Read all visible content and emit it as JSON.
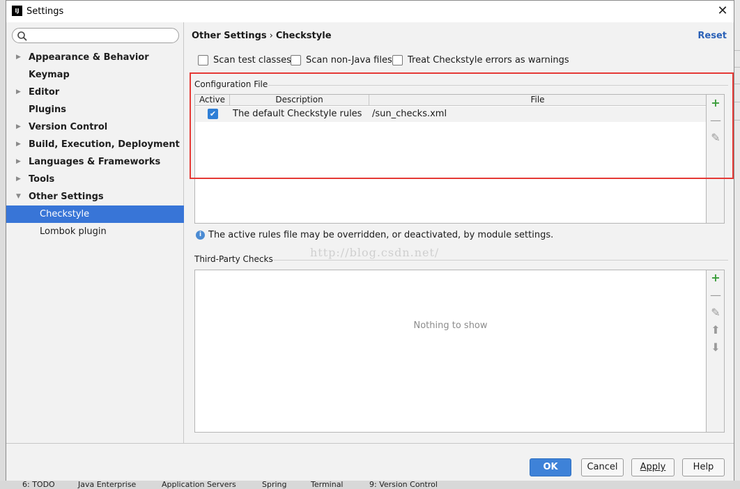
{
  "window": {
    "title": "Settings",
    "logo": "IJ"
  },
  "search": {
    "placeholder": ""
  },
  "sidebar": {
    "items": [
      {
        "label": "Appearance & Behavior"
      },
      {
        "label": "Keymap"
      },
      {
        "label": "Editor"
      },
      {
        "label": "Plugins"
      },
      {
        "label": "Version Control"
      },
      {
        "label": "Build, Execution, Deployment"
      },
      {
        "label": "Languages & Frameworks"
      },
      {
        "label": "Tools"
      },
      {
        "label": "Other Settings"
      },
      {
        "label": "Checkstyle"
      },
      {
        "label": "Lombok plugin"
      }
    ]
  },
  "breadcrumb": {
    "parent": "Other Settings",
    "separator": "›",
    "current": "Checkstyle"
  },
  "reset_label": "Reset",
  "options": {
    "scan_tests": "Scan test classes",
    "scan_non_java": "Scan non-Java files",
    "treat_as_warnings": "Treat Checkstyle errors as warnings"
  },
  "config": {
    "group_title": "Configuration File",
    "columns": [
      "Active",
      "Description",
      "File"
    ],
    "rows": [
      {
        "active": true,
        "description": "The default Checkstyle rules",
        "file": "/sun_checks.xml"
      }
    ]
  },
  "info_text": "The active rules file may be overridden, or deactivated, by module settings.",
  "watermark": "http://blog.csdn.net/",
  "third_party": {
    "group_title": "Third-Party Checks",
    "empty_text": "Nothing to show"
  },
  "buttons": {
    "ok": "OK",
    "cancel": "Cancel",
    "apply": "Apply",
    "help": "Help"
  },
  "taskbar": [
    "6: TODO",
    "Java Enterprise",
    "Application Servers",
    "Spring",
    "Terminal",
    "9: Version Control"
  ],
  "colors": {
    "selection": "#3875d7",
    "accent_link": "#2b61b7",
    "highlight_border": "#e53935",
    "ok_button": "#3e82d8",
    "add_icon": "#3a9d3a"
  }
}
